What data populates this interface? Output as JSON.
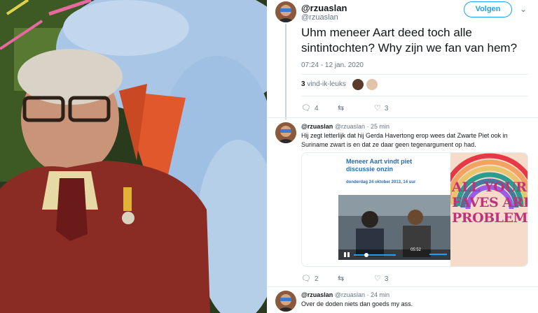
{
  "main_tweet": {
    "display_name": "@rzuaslan",
    "handle": "@rzuaslan",
    "follow_label": "Volgen",
    "text": "Uhm meneer Aart deed toch alle sintintochten? Why zijn we fan van hem?",
    "timestamp": "07:24 - 12 jan. 2020",
    "likes_count": "3",
    "likes_label": "vind-ik-leuks",
    "actions": {
      "replies": "4",
      "retweets": "",
      "likes": "3"
    }
  },
  "reply1": {
    "display_name": "@rzuaslan",
    "handle": "@rzuaslan",
    "time": "25 min",
    "text": "Hij zegt letterlijk dat hij Gerda Havertong erop wees dat Zwarte Piet ook in Suriname zwart is en dat ze daar geen tegenargument op had.",
    "article_title": "Meneer Aart vindt piet discussie onzin",
    "article_date": "donderdag 24 oktober 2013, 14 uur",
    "video_time": "05:52",
    "meme_text": "ALL YOUR\nFAVES ARE\nPROBLEMATI",
    "actions": {
      "replies": "2",
      "retweets": "",
      "likes": "3"
    }
  },
  "reply2": {
    "display_name": "@rzuaslan",
    "handle": "@rzuaslan",
    "time": "24 min",
    "text": "Over de doden niets dan goeds my ass."
  },
  "colors": {
    "accent": "#1da1f2",
    "text": "#14171a",
    "muted": "#657786",
    "divider": "#e6ecf0"
  },
  "icons": {
    "reply": "reply-icon",
    "retweet": "retweet-icon",
    "like": "heart-icon",
    "more": "chevron-down-icon"
  }
}
